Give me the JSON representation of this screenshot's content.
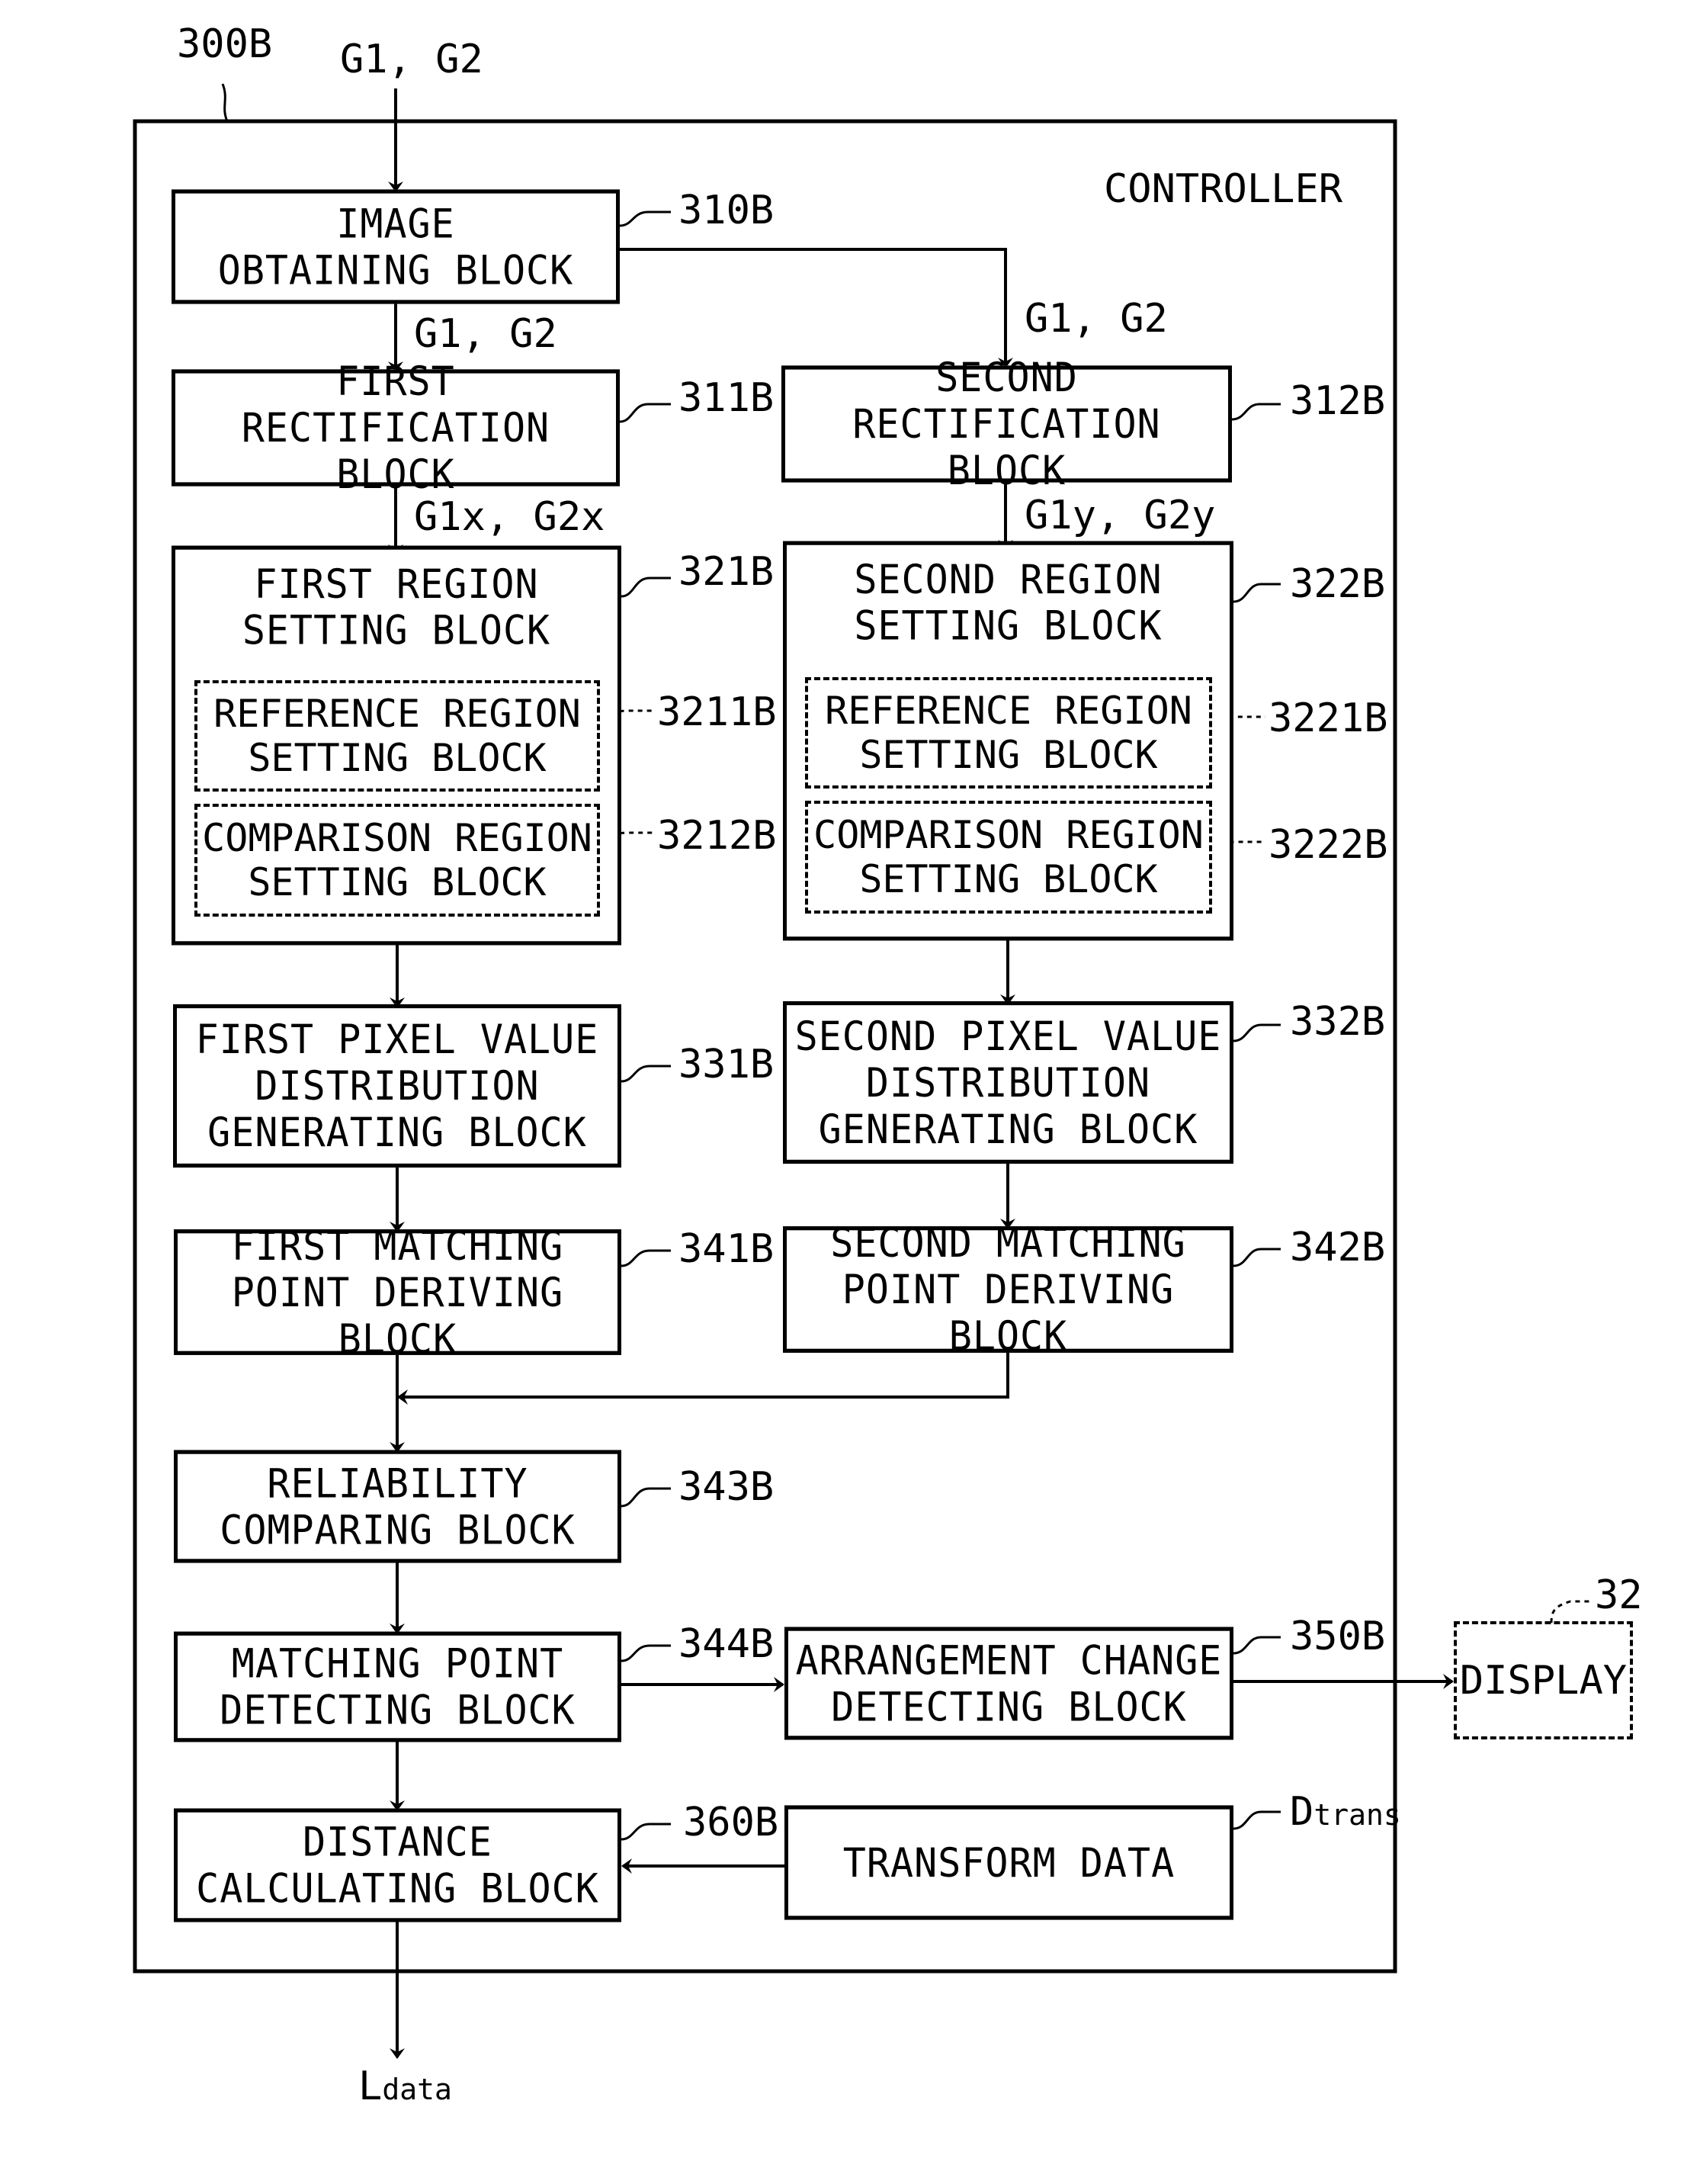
{
  "figure": {
    "ref": "300B",
    "title": "CONTROLLER",
    "input_signal": "G1, G2",
    "output_signal": {
      "main": "L",
      "sub": "data"
    }
  },
  "blocks": {
    "image_obtaining": {
      "ref": "310B",
      "lines": [
        "IMAGE",
        "OBTAINING BLOCK"
      ]
    },
    "first_rect": {
      "ref": "311B",
      "lines": [
        "FIRST",
        "RECTIFICATION BLOCK"
      ]
    },
    "second_rect": {
      "ref": "312B",
      "lines": [
        "SECOND",
        "RECTIFICATION BLOCK"
      ]
    },
    "first_region": {
      "ref": "321B",
      "lines": [
        "FIRST REGION",
        "SETTING BLOCK"
      ]
    },
    "first_reference": {
      "ref": "3211B",
      "lines": [
        "REFERENCE REGION",
        "SETTING BLOCK"
      ]
    },
    "first_comparison": {
      "ref": "3212B",
      "lines": [
        "COMPARISON REGION",
        "SETTING BLOCK"
      ]
    },
    "second_region": {
      "ref": "322B",
      "lines": [
        "SECOND REGION",
        "SETTING BLOCK"
      ]
    },
    "second_reference": {
      "ref": "3221B",
      "lines": [
        "REFERENCE REGION",
        "SETTING BLOCK"
      ]
    },
    "second_comparison": {
      "ref": "3222B",
      "lines": [
        "COMPARISON REGION",
        "SETTING BLOCK"
      ]
    },
    "first_pixel": {
      "ref": "331B",
      "lines": [
        "FIRST PIXEL VALUE",
        "DISTRIBUTION",
        "GENERATING BLOCK"
      ]
    },
    "second_pixel": {
      "ref": "332B",
      "lines": [
        "SECOND PIXEL VALUE",
        "DISTRIBUTION",
        "GENERATING BLOCK"
      ]
    },
    "first_matching": {
      "ref": "341B",
      "lines": [
        "FIRST MATCHING",
        "POINT DERIVING BLOCK"
      ]
    },
    "second_matching": {
      "ref": "342B",
      "lines": [
        "SECOND MATCHING",
        "POINT DERIVING BLOCK"
      ]
    },
    "reliability": {
      "ref": "343B",
      "lines": [
        "RELIABILITY",
        "COMPARING BLOCK"
      ]
    },
    "matching_detect": {
      "ref": "344B",
      "lines": [
        "MATCHING POINT",
        "DETECTING BLOCK"
      ]
    },
    "arrangement": {
      "ref": "350B",
      "lines": [
        "ARRANGEMENT CHANGE",
        "DETECTING BLOCK"
      ]
    },
    "distance": {
      "ref": "360B",
      "lines": [
        "DISTANCE",
        "CALCULATING BLOCK"
      ]
    },
    "transform": {
      "ref_main": "D",
      "ref_sub": "trans",
      "lines": [
        "TRANSFORM DATA"
      ]
    },
    "display": {
      "ref": "32",
      "label": "DISPLAY"
    }
  },
  "edge_labels": {
    "to_first_rect": "G1, G2",
    "to_second_rect": "G1, G2",
    "from_first_rect": "G1x, G2x",
    "from_second_rect": "G1y, G2y"
  }
}
